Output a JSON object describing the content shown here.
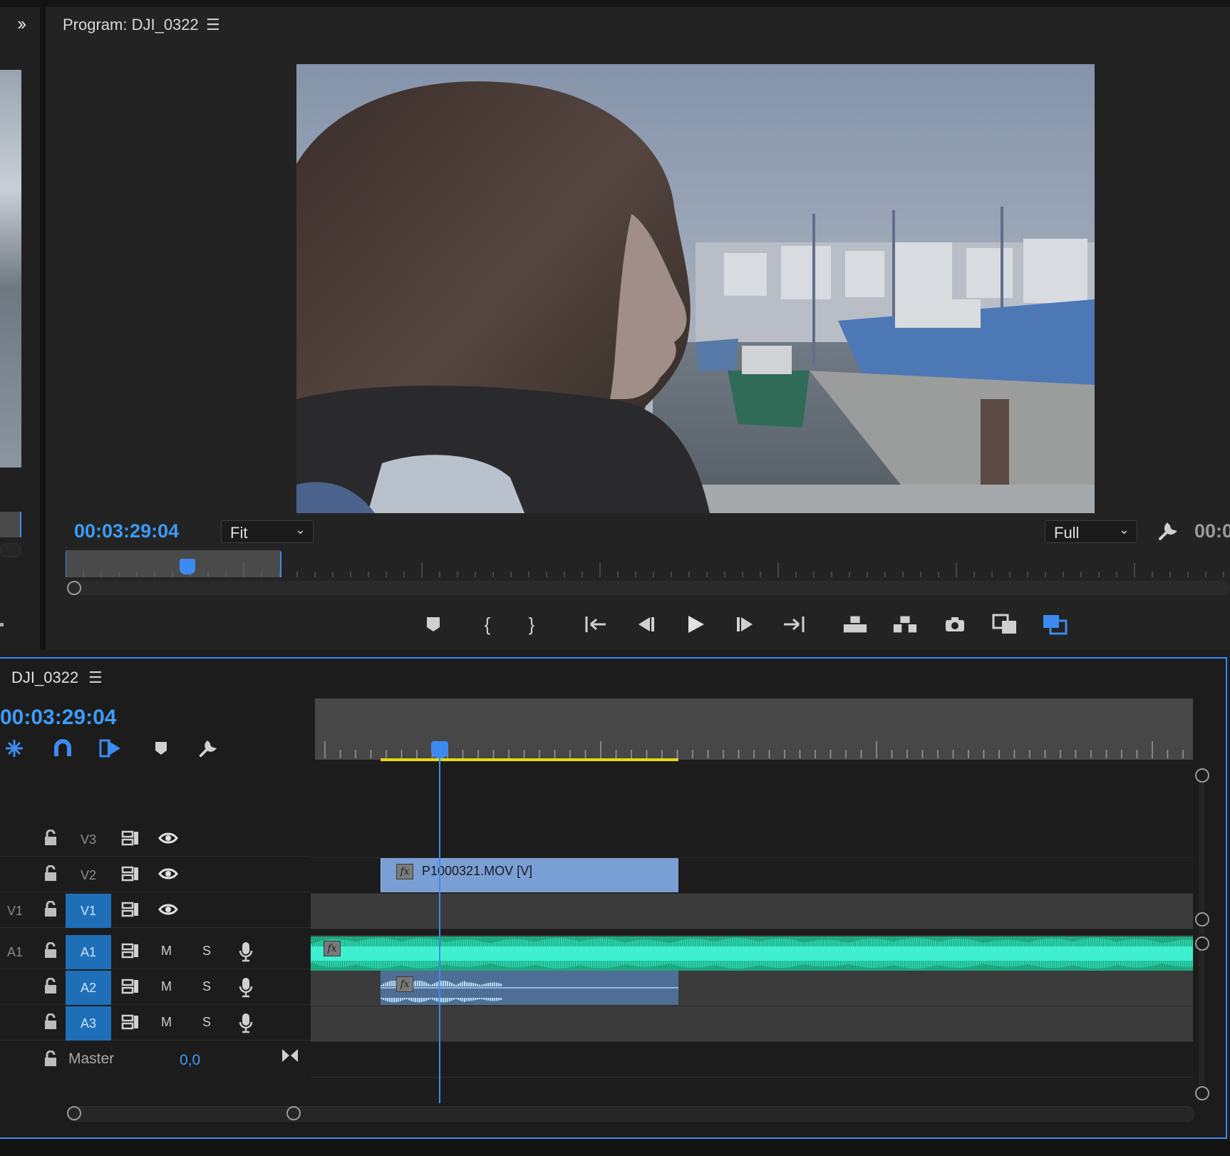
{
  "program": {
    "title": "Program: DJI_0322",
    "timecode": "00:03:29:04",
    "fit_label": "Fit",
    "quality_label": "Full",
    "right_timecode": "00:0"
  },
  "transport": {
    "buttons": [
      "add-marker",
      "mark-in",
      "mark-out",
      "go-to-in",
      "step-back",
      "play",
      "step-forward",
      "go-to-out",
      "lift",
      "extract",
      "export-frame",
      "compare-view",
      "proxy-toggle"
    ]
  },
  "timeline": {
    "sequence_name": "DJI_0322",
    "timecode": "00:03:29:04",
    "tracks": [
      {
        "source": "",
        "name": "V3",
        "type": "video",
        "active": false
      },
      {
        "source": "",
        "name": "V2",
        "type": "video",
        "active": false
      },
      {
        "source": "V1",
        "name": "V1",
        "type": "video",
        "active": true
      },
      {
        "source": "A1",
        "name": "A1",
        "type": "audio",
        "active": true
      },
      {
        "source": "",
        "name": "A2",
        "type": "audio",
        "active": true
      },
      {
        "source": "",
        "name": "A3",
        "type": "audio",
        "active": true
      }
    ],
    "m_label": "M",
    "s_label": "S",
    "master_label": "Master",
    "master_value": "0,0",
    "clips": {
      "v2_name": "P1000321.MOV [V]",
      "fx_label": "fx"
    }
  },
  "colors": {
    "accent": "#3d8bf0",
    "video_clip": "#7a9fd4",
    "audio_clip": "#1fa77e",
    "work_area": "#e4d815"
  }
}
